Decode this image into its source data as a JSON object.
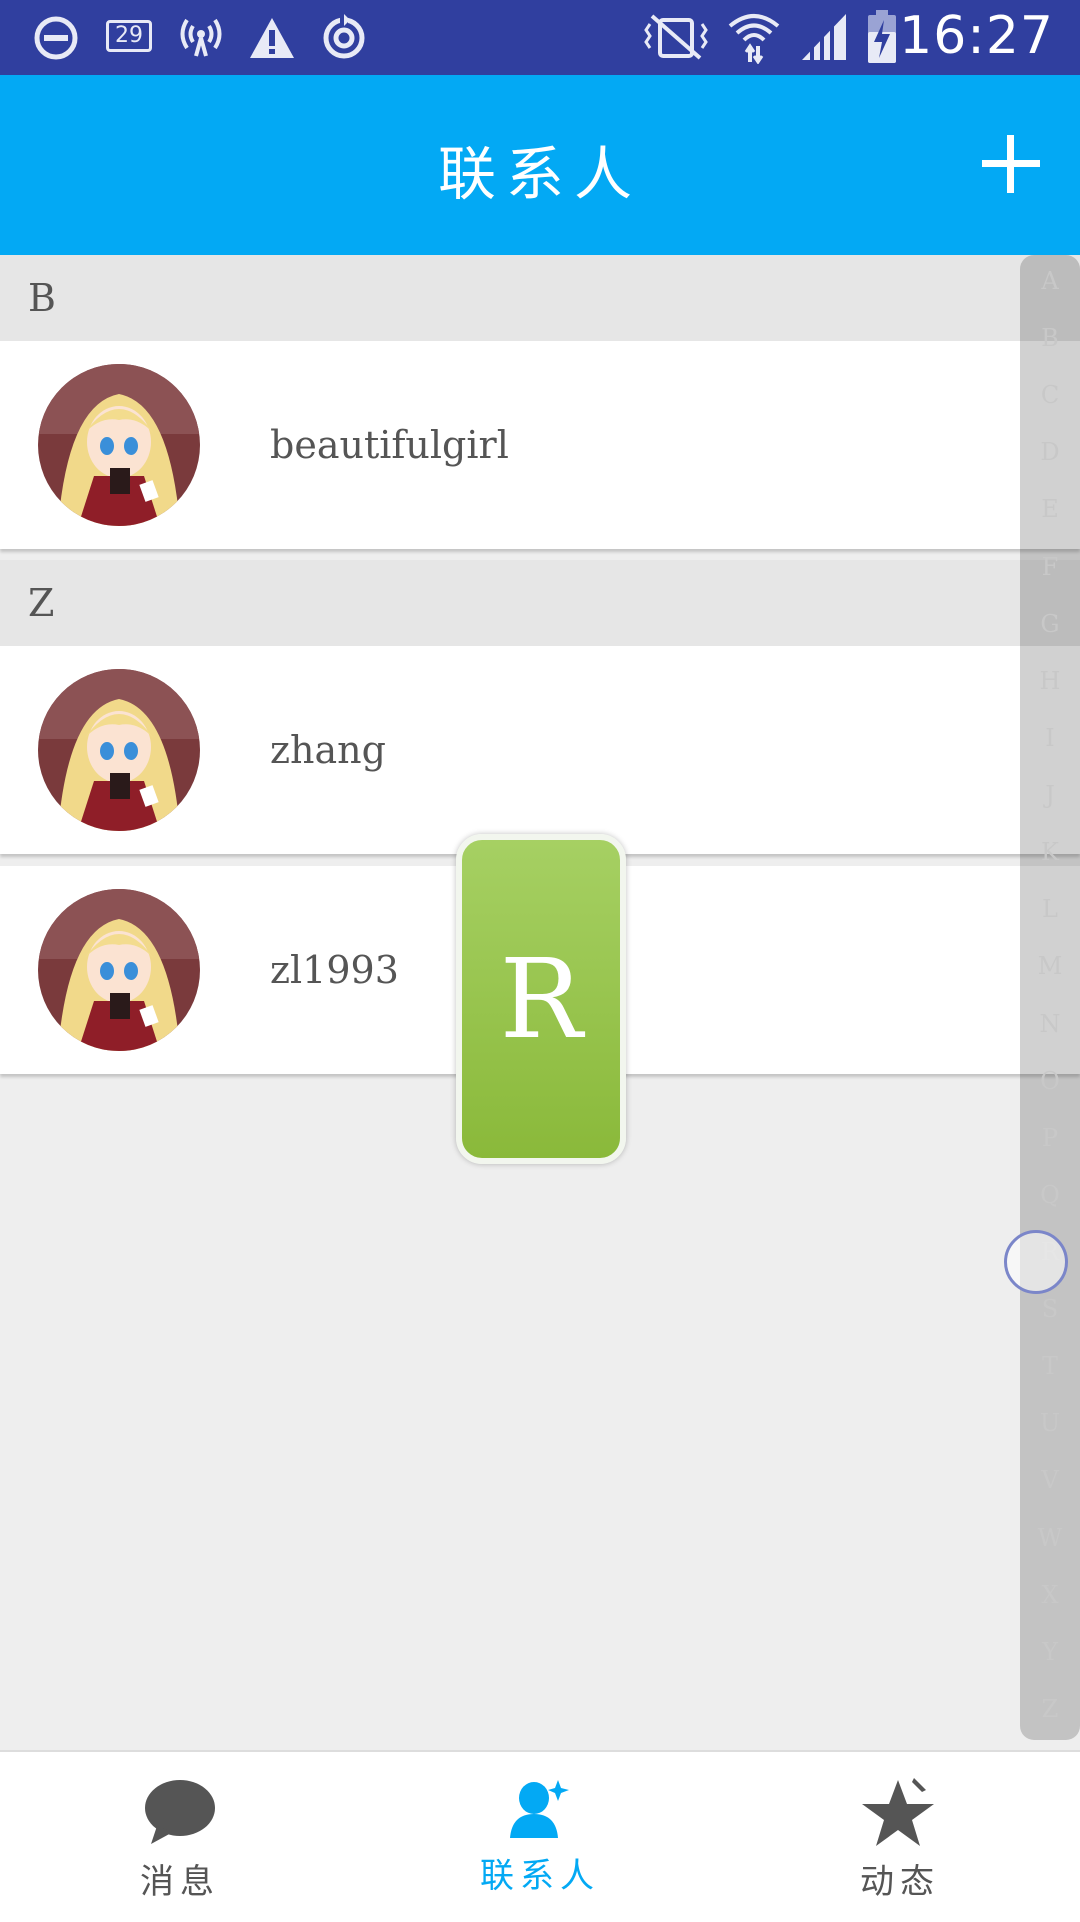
{
  "status_bar": {
    "time": "16:27",
    "notification_count": "29",
    "icons": [
      "do-not-disturb-icon",
      "notification-badge-icon",
      "hotspot-icon",
      "warning-icon",
      "sync-icon",
      "vibrate-off-icon",
      "wifi-icon",
      "signal-icon",
      "battery-charging-icon"
    ]
  },
  "header": {
    "title": "联系人",
    "add_icon": "plus-icon"
  },
  "contacts": {
    "sections": [
      {
        "letter": "B",
        "items": [
          {
            "name": "beautifulgirl"
          }
        ]
      },
      {
        "letter": "Z",
        "items": [
          {
            "name": "zhang"
          },
          {
            "name": "zl1993"
          }
        ]
      }
    ]
  },
  "index": {
    "letters": [
      "A",
      "B",
      "C",
      "D",
      "E",
      "F",
      "G",
      "H",
      "I",
      "J",
      "K",
      "L",
      "M",
      "N",
      "O",
      "P",
      "Q",
      "R",
      "S",
      "T",
      "U",
      "V",
      "W",
      "X",
      "Y",
      "Z"
    ],
    "selected": "R"
  },
  "overlay": {
    "letter": "R"
  },
  "nav": {
    "items": [
      {
        "label": "消息",
        "icon": "chat-bubble-icon",
        "active": false
      },
      {
        "label": "联系人",
        "icon": "contact-person-icon",
        "active": true
      },
      {
        "label": "动态",
        "icon": "star-icon",
        "active": false
      }
    ],
    "active_color": "#03a9f4",
    "inactive_color": "#555555"
  },
  "colors": {
    "status_bar": "#303f9f",
    "title_bar": "#03a9f4",
    "overlay": "#8bc34a"
  }
}
